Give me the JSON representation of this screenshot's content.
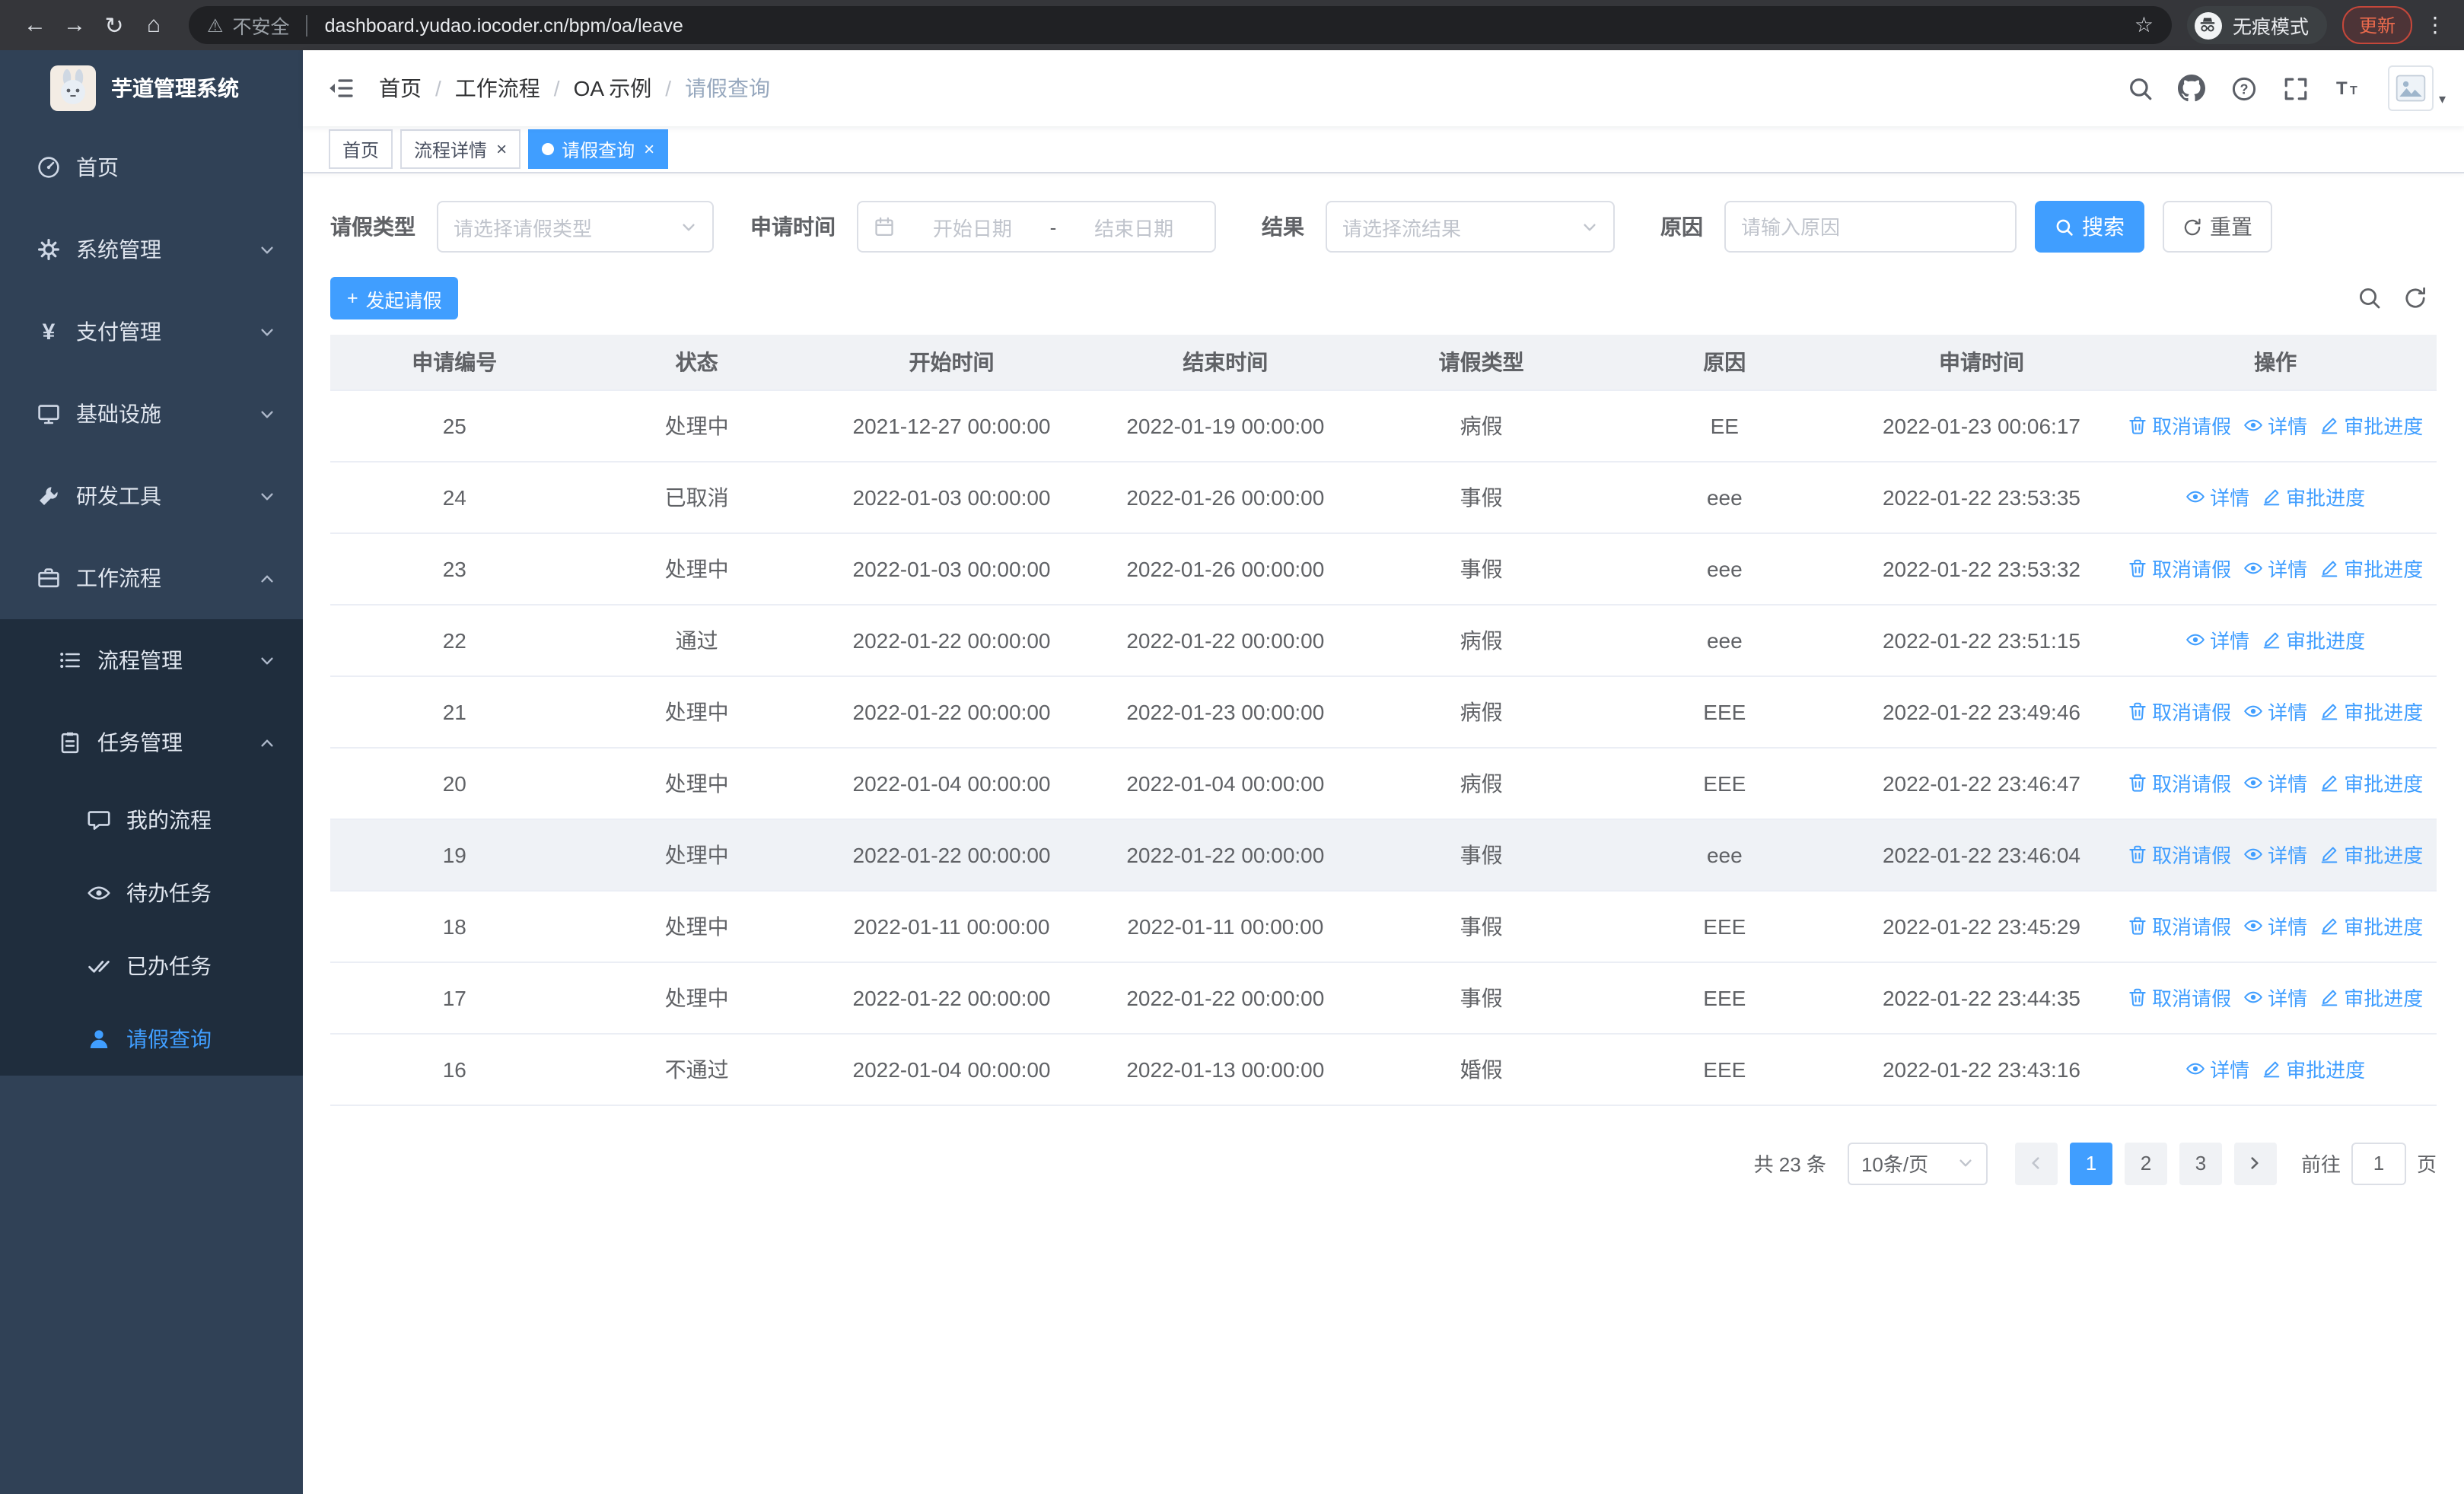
{
  "browser": {
    "security_label": "不安全",
    "url": "dashboard.yudao.iocoder.cn/bpm/oa/leave",
    "incognito_label": "无痕模式",
    "update_label": "更新"
  },
  "icons": {
    "back": "←",
    "forward": "→",
    "reload": "↻",
    "home": "⌂",
    "warning": "⚠",
    "star": "☆",
    "menu": "⋮",
    "caret": "▾",
    "yen": "¥",
    "plus": "+"
  },
  "sidebar": {
    "app_title": "芋道管理系统",
    "items": [
      {
        "label": "首页"
      },
      {
        "label": "系统管理"
      },
      {
        "label": "支付管理"
      },
      {
        "label": "基础设施"
      },
      {
        "label": "研发工具"
      },
      {
        "label": "工作流程"
      }
    ],
    "workflow_children": [
      {
        "label": "流程管理"
      },
      {
        "label": "任务管理"
      }
    ],
    "task_children": [
      {
        "label": "我的流程"
      },
      {
        "label": "待办任务"
      },
      {
        "label": "已办任务"
      },
      {
        "label": "请假查询"
      }
    ]
  },
  "header": {
    "breadcrumb": [
      "首页",
      "工作流程",
      "OA 示例",
      "请假查询"
    ]
  },
  "tabs": [
    {
      "label": "首页"
    },
    {
      "label": "流程详情"
    },
    {
      "label": "请假查询"
    }
  ],
  "filters": {
    "leave_type_label": "请假类型",
    "leave_type_placeholder": "请选择请假类型",
    "apply_time_label": "申请时间",
    "start_date_placeholder": "开始日期",
    "range_separator": "-",
    "end_date_placeholder": "结束日期",
    "result_label": "结果",
    "result_placeholder": "请选择流结果",
    "reason_label": "原因",
    "reason_placeholder": "请输入原因",
    "search_button": "搜索",
    "reset_button": "重置"
  },
  "toolbar": {
    "create_button": "发起请假"
  },
  "table": {
    "columns": [
      "申请编号",
      "状态",
      "开始时间",
      "结束时间",
      "请假类型",
      "原因",
      "申请时间",
      "操作"
    ],
    "action_labels": {
      "cancel": "取消请假",
      "detail": "详情",
      "progress": "审批进度"
    },
    "rows": [
      {
        "id": "25",
        "status": "处理中",
        "start": "2021-12-27 00:00:00",
        "end": "2022-01-19 00:00:00",
        "type": "病假",
        "reason": "EE",
        "apply_time": "2022-01-23 00:06:17",
        "actions": [
          "cancel",
          "detail",
          "progress"
        ],
        "highlight": false
      },
      {
        "id": "24",
        "status": "已取消",
        "start": "2022-01-03 00:00:00",
        "end": "2022-01-26 00:00:00",
        "type": "事假",
        "reason": "eee",
        "apply_time": "2022-01-22 23:53:35",
        "actions": [
          "detail",
          "progress"
        ],
        "highlight": false
      },
      {
        "id": "23",
        "status": "处理中",
        "start": "2022-01-03 00:00:00",
        "end": "2022-01-26 00:00:00",
        "type": "事假",
        "reason": "eee",
        "apply_time": "2022-01-22 23:53:32",
        "actions": [
          "cancel",
          "detail",
          "progress"
        ],
        "highlight": false
      },
      {
        "id": "22",
        "status": "通过",
        "start": "2022-01-22 00:00:00",
        "end": "2022-01-22 00:00:00",
        "type": "病假",
        "reason": "eee",
        "apply_time": "2022-01-22 23:51:15",
        "actions": [
          "detail",
          "progress"
        ],
        "highlight": false
      },
      {
        "id": "21",
        "status": "处理中",
        "start": "2022-01-22 00:00:00",
        "end": "2022-01-23 00:00:00",
        "type": "病假",
        "reason": "EEE",
        "apply_time": "2022-01-22 23:49:46",
        "actions": [
          "cancel",
          "detail",
          "progress"
        ],
        "highlight": false
      },
      {
        "id": "20",
        "status": "处理中",
        "start": "2022-01-04 00:00:00",
        "end": "2022-01-04 00:00:00",
        "type": "病假",
        "reason": "EEE",
        "apply_time": "2022-01-22 23:46:47",
        "actions": [
          "cancel",
          "detail",
          "progress"
        ],
        "highlight": false
      },
      {
        "id": "19",
        "status": "处理中",
        "start": "2022-01-22 00:00:00",
        "end": "2022-01-22 00:00:00",
        "type": "事假",
        "reason": "eee",
        "apply_time": "2022-01-22 23:46:04",
        "actions": [
          "cancel",
          "detail",
          "progress"
        ],
        "highlight": true
      },
      {
        "id": "18",
        "status": "处理中",
        "start": "2022-01-11 00:00:00",
        "end": "2022-01-11 00:00:00",
        "type": "事假",
        "reason": "EEE",
        "apply_time": "2022-01-22 23:45:29",
        "actions": [
          "cancel",
          "detail",
          "progress"
        ],
        "highlight": false
      },
      {
        "id": "17",
        "status": "处理中",
        "start": "2022-01-22 00:00:00",
        "end": "2022-01-22 00:00:00",
        "type": "事假",
        "reason": "EEE",
        "apply_time": "2022-01-22 23:44:35",
        "actions": [
          "cancel",
          "detail",
          "progress"
        ],
        "highlight": false
      },
      {
        "id": "16",
        "status": "不通过",
        "start": "2022-01-04 00:00:00",
        "end": "2022-01-13 00:00:00",
        "type": "婚假",
        "reason": "EEE",
        "apply_time": "2022-01-22 23:43:16",
        "actions": [
          "detail",
          "progress"
        ],
        "highlight": false
      }
    ]
  },
  "pagination": {
    "total_label": "共 23 条",
    "page_size": "10条/页",
    "pages": [
      "1",
      "2",
      "3"
    ],
    "active_page": "1",
    "goto_label": "前往",
    "goto_value": "1",
    "goto_suffix": "页"
  },
  "colors": {
    "primary": "#409eff",
    "sidebar_bg": "#304156",
    "submenu_bg": "#1f2d3d",
    "table_header_bg": "#f0f2f5",
    "update_pill": "#e8694c"
  }
}
